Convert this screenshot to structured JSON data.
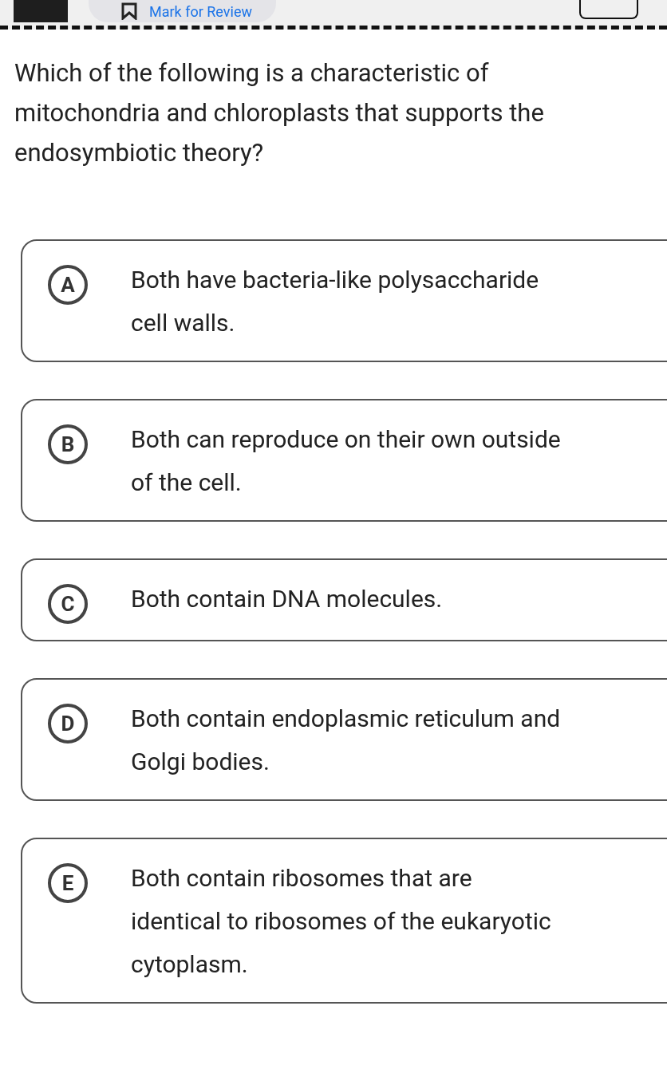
{
  "toolbar": {
    "mark_label": "Mark for Review"
  },
  "question": "Which of the following is a characteristic of mitochondria and chloroplasts that supports the endosymbiotic theory?",
  "options": [
    {
      "letter": "A",
      "text": "Both have bacteria-like polysaccharide cell walls.",
      "selected": false
    },
    {
      "letter": "B",
      "text": "Both can reproduce on their own outside of the cell.",
      "selected": false
    },
    {
      "letter": "C",
      "text": "Both contain DNA molecules.",
      "selected": false
    },
    {
      "letter": "D",
      "text": "Both contain endoplasmic reticulum and Golgi bodies.",
      "selected": false
    },
    {
      "letter": "E",
      "text": "Both contain ribosomes that are identical to ribosomes of the eukaryotic cytoplasm.",
      "selected": false
    }
  ]
}
